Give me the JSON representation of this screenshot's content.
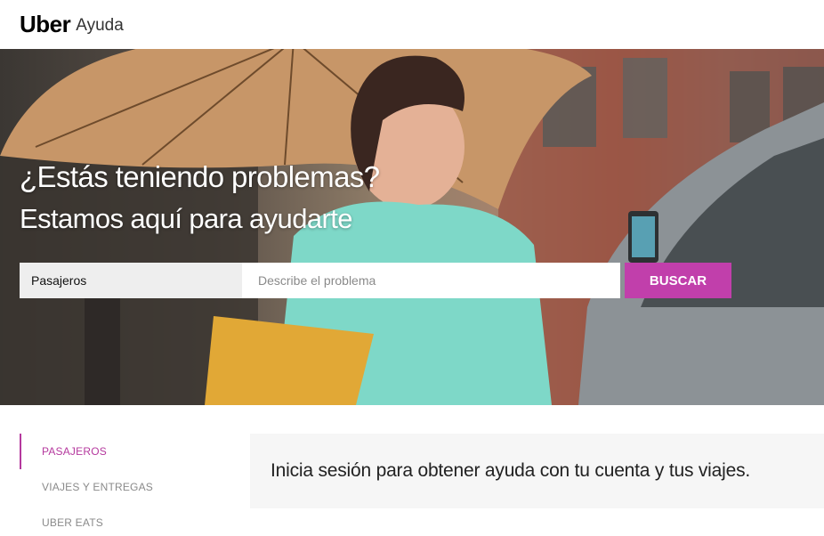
{
  "header": {
    "brand": "Uber",
    "section": "Ayuda"
  },
  "hero": {
    "title": "¿Estás teniendo problemas?",
    "subtitle": "Estamos aquí para ayudarte",
    "search": {
      "category": "Pasajeros",
      "placeholder": "Describe el problema",
      "button_label": "BUSCAR"
    }
  },
  "sidebar": {
    "items": [
      {
        "label": "PASAJEROS",
        "active": true
      },
      {
        "label": "VIAJES Y ENTREGAS",
        "active": false
      },
      {
        "label": "UBER EATS",
        "active": false
      }
    ]
  },
  "main": {
    "signin_prompt": "Inicia sesión para obtener ayuda con tu cuenta y tus viajes."
  },
  "colors": {
    "accent": "#c13fab",
    "active_nav": "#b5399e",
    "panel_bg": "#f6f6f6"
  }
}
